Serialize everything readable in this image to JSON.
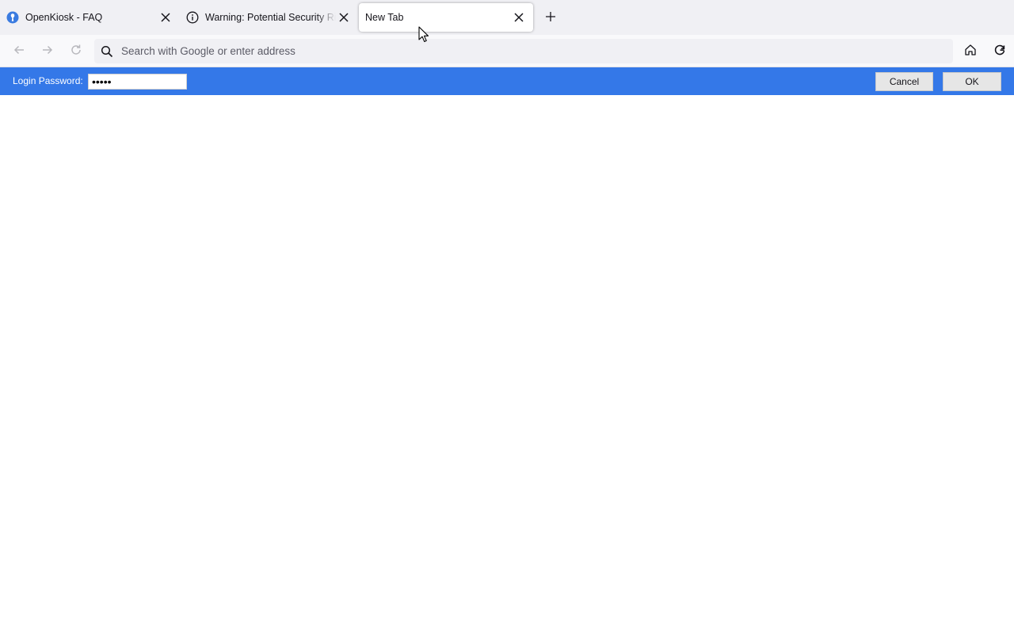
{
  "tabs": [
    {
      "title": "OpenKiosk - FAQ",
      "icon": "openkiosk-favicon-icon",
      "active": false
    },
    {
      "title": "Warning: Potential Security Risk Ahead",
      "icon": "info-icon",
      "active": false
    },
    {
      "title": "New Tab",
      "icon": "",
      "active": true
    }
  ],
  "navbar": {
    "back_icon": "back-arrow-icon",
    "forward_icon": "forward-arrow-icon",
    "reload_icon": "reload-icon",
    "search_placeholder": "Search with Google or enter address",
    "home_icon": "home-icon",
    "refresh_icon": "reset-session-icon"
  },
  "loginbar": {
    "label": "Login Password:",
    "password_value": "•••••",
    "cancel_label": "Cancel",
    "ok_label": "OK",
    "background_color": "#3478e8"
  }
}
